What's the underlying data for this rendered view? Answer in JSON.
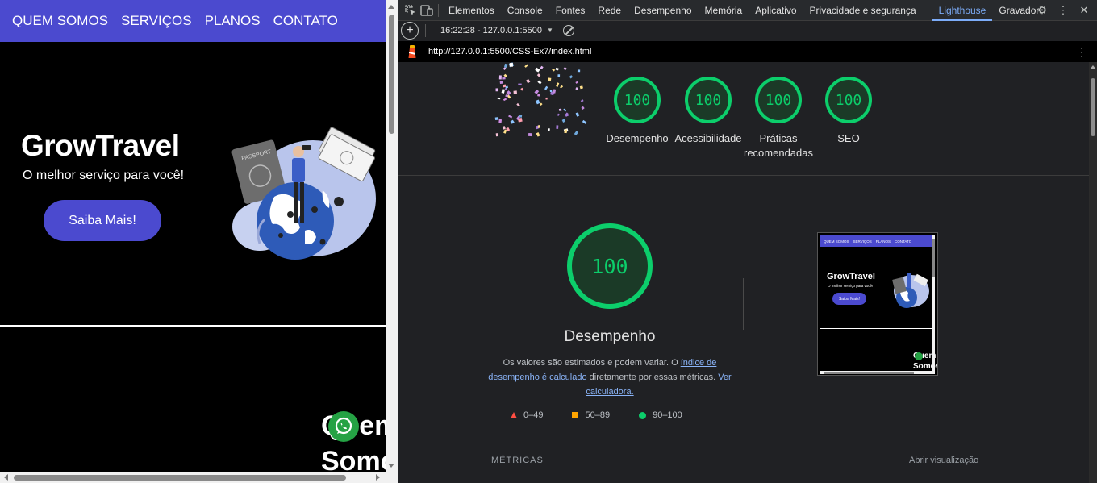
{
  "site": {
    "nav": [
      "QUEM SOMOS",
      "SERVIÇOS",
      "PLANOS",
      "CONTATO"
    ],
    "hero": {
      "title": "GrowTravel",
      "subtitle": "O melhor serviço para você!",
      "button": "Saiba Mais!"
    },
    "about_title": "Quem Somos",
    "passport_label": "PASSPORT"
  },
  "devtools": {
    "tabs": [
      "Elementos",
      "Console",
      "Fontes",
      "Rede",
      "Desempenho",
      "Memória",
      "Aplicativo",
      "Privacidade e segurança",
      "Lighthouse",
      "Gravador"
    ],
    "active_tab": "Lighthouse",
    "report_selector": "16:22:28 - 127.0.0.1:5500",
    "url": "http://127.0.0.1:5500/CSS-Ex7/index.html"
  },
  "report": {
    "scores": [
      {
        "value": "100",
        "label": "Desempenho"
      },
      {
        "value": "100",
        "label": "Acessibilidade"
      },
      {
        "value": "100",
        "label": "Práticas recomendadas"
      },
      {
        "value": "100",
        "label": "SEO"
      }
    ],
    "main_score": "100",
    "main_label": "Desempenho",
    "desc_1": "Os valores são estimados e podem variar. O ",
    "desc_link_1": "índice de desempenho é calculado",
    "desc_2": " diretamente por essas métricas. ",
    "desc_link_2": "Ver calculadora.",
    "legend": [
      "0–49",
      "50–89",
      "90–100"
    ],
    "metrics_title": "MÉTRICAS",
    "metrics_toggle": "Abrir visualização",
    "colors": {
      "pass": "#0cce6b",
      "average": "#ffa400",
      "fail": "#ff4e42"
    }
  },
  "thumbnail": {
    "nav": [
      "QUEM SOMOS",
      "SERVIÇOS",
      "PLANOS",
      "CONTATO"
    ],
    "title": "GrowTravel",
    "subtitle": "O melhor serviço para você!",
    "button": "Saiba Mais!",
    "about": "Quem Somos"
  }
}
